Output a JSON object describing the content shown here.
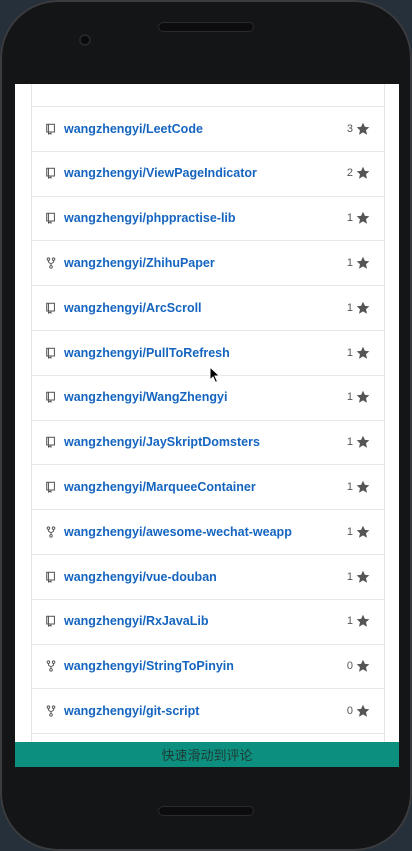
{
  "repos": [
    {
      "name": "wangzhengyi/LeetCode",
      "stars": "3",
      "icon": "repo-icon"
    },
    {
      "name": "wangzhengyi/ViewPageIndicator",
      "stars": "2",
      "icon": "repo-icon"
    },
    {
      "name": "wangzhengyi/phppractise-lib",
      "stars": "1",
      "icon": "repo-icon"
    },
    {
      "name": "wangzhengyi/ZhihuPaper",
      "stars": "1",
      "icon": "fork-icon"
    },
    {
      "name": "wangzhengyi/ArcScroll",
      "stars": "1",
      "icon": "repo-icon"
    },
    {
      "name": "wangzhengyi/PullToRefresh",
      "stars": "1",
      "icon": "repo-icon"
    },
    {
      "name": "wangzhengyi/WangZhengyi",
      "stars": "1",
      "icon": "repo-icon"
    },
    {
      "name": "wangzhengyi/JaySkriptDomsters",
      "stars": "1",
      "icon": "repo-icon"
    },
    {
      "name": "wangzhengyi/MarqueeContainer",
      "stars": "1",
      "icon": "repo-icon"
    },
    {
      "name": "wangzhengyi/awesome-wechat-weapp",
      "stars": "1",
      "icon": "fork-icon"
    },
    {
      "name": "wangzhengyi/vue-douban",
      "stars": "1",
      "icon": "repo-icon"
    },
    {
      "name": "wangzhengyi/RxJavaLib",
      "stars": "1",
      "icon": "repo-icon"
    },
    {
      "name": "wangzhengyi/StringToPinyin",
      "stars": "0",
      "icon": "fork-icon"
    },
    {
      "name": "wangzhengyi/git-script",
      "stars": "0",
      "icon": "fork-icon"
    }
  ],
  "bottom_bar": {
    "label": "快速滑动到评论"
  },
  "colors": {
    "link": "#1565c0",
    "bar": "#0c8f7e"
  }
}
